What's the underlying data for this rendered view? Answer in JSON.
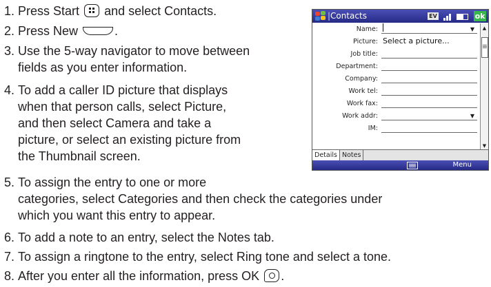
{
  "steps": [
    {
      "num": "1.",
      "before": "Press Start",
      "icon": "start-key-icon",
      "after": "and select Contacts."
    },
    {
      "num": "2.",
      "before": "Press New",
      "icon": "new-key-icon",
      "after": "."
    },
    {
      "num": "3.",
      "lines": [
        "Use the 5-way navigator to move between",
        "fields as you enter information."
      ]
    },
    {
      "num": "4.",
      "lines": [
        "To add a caller ID picture that displays",
        "when that person calls, select Picture,",
        "and then select Camera and take a",
        "picture, or select an existing picture from",
        "the Thumbnail screen."
      ]
    },
    {
      "num": "5.",
      "lines": [
        "To assign the entry to one or more",
        "categories, select Categories and then check the categories under",
        "which you want this entry to appear."
      ]
    },
    {
      "num": "6.",
      "lines": [
        "To add a note to an entry, select the Notes tab."
      ]
    },
    {
      "num": "7.",
      "lines": [
        "To assign a ringtone to the entry, select Ring tone and select a tone."
      ]
    },
    {
      "num": "8.",
      "before": "After you enter all the information, press OK",
      "icon": "ok-key-icon",
      "after": "."
    }
  ],
  "device": {
    "title": "Contacts",
    "ev_label": "EV",
    "ok_label": "ok",
    "fields": [
      {
        "label": "Name:",
        "value": "",
        "dropdown": true,
        "cursor": true
      },
      {
        "label": "Picture:",
        "value": "Select a picture...",
        "dropdown": false
      },
      {
        "label": "Job title:",
        "value": "",
        "dropdown": false
      },
      {
        "label": "Department:",
        "value": "",
        "dropdown": false
      },
      {
        "label": "Company:",
        "value": "",
        "dropdown": false
      },
      {
        "label": "Work tel:",
        "value": "",
        "dropdown": false
      },
      {
        "label": "Work fax:",
        "value": "",
        "dropdown": false
      },
      {
        "label": "Work addr:",
        "value": "",
        "dropdown": true
      },
      {
        "label": "IM:",
        "value": "",
        "dropdown": false
      }
    ],
    "tabs": [
      "Details",
      "Notes"
    ],
    "menu_label": "Menu",
    "title_bar_color": "#2f3493",
    "ok_color": "#38b84a"
  }
}
